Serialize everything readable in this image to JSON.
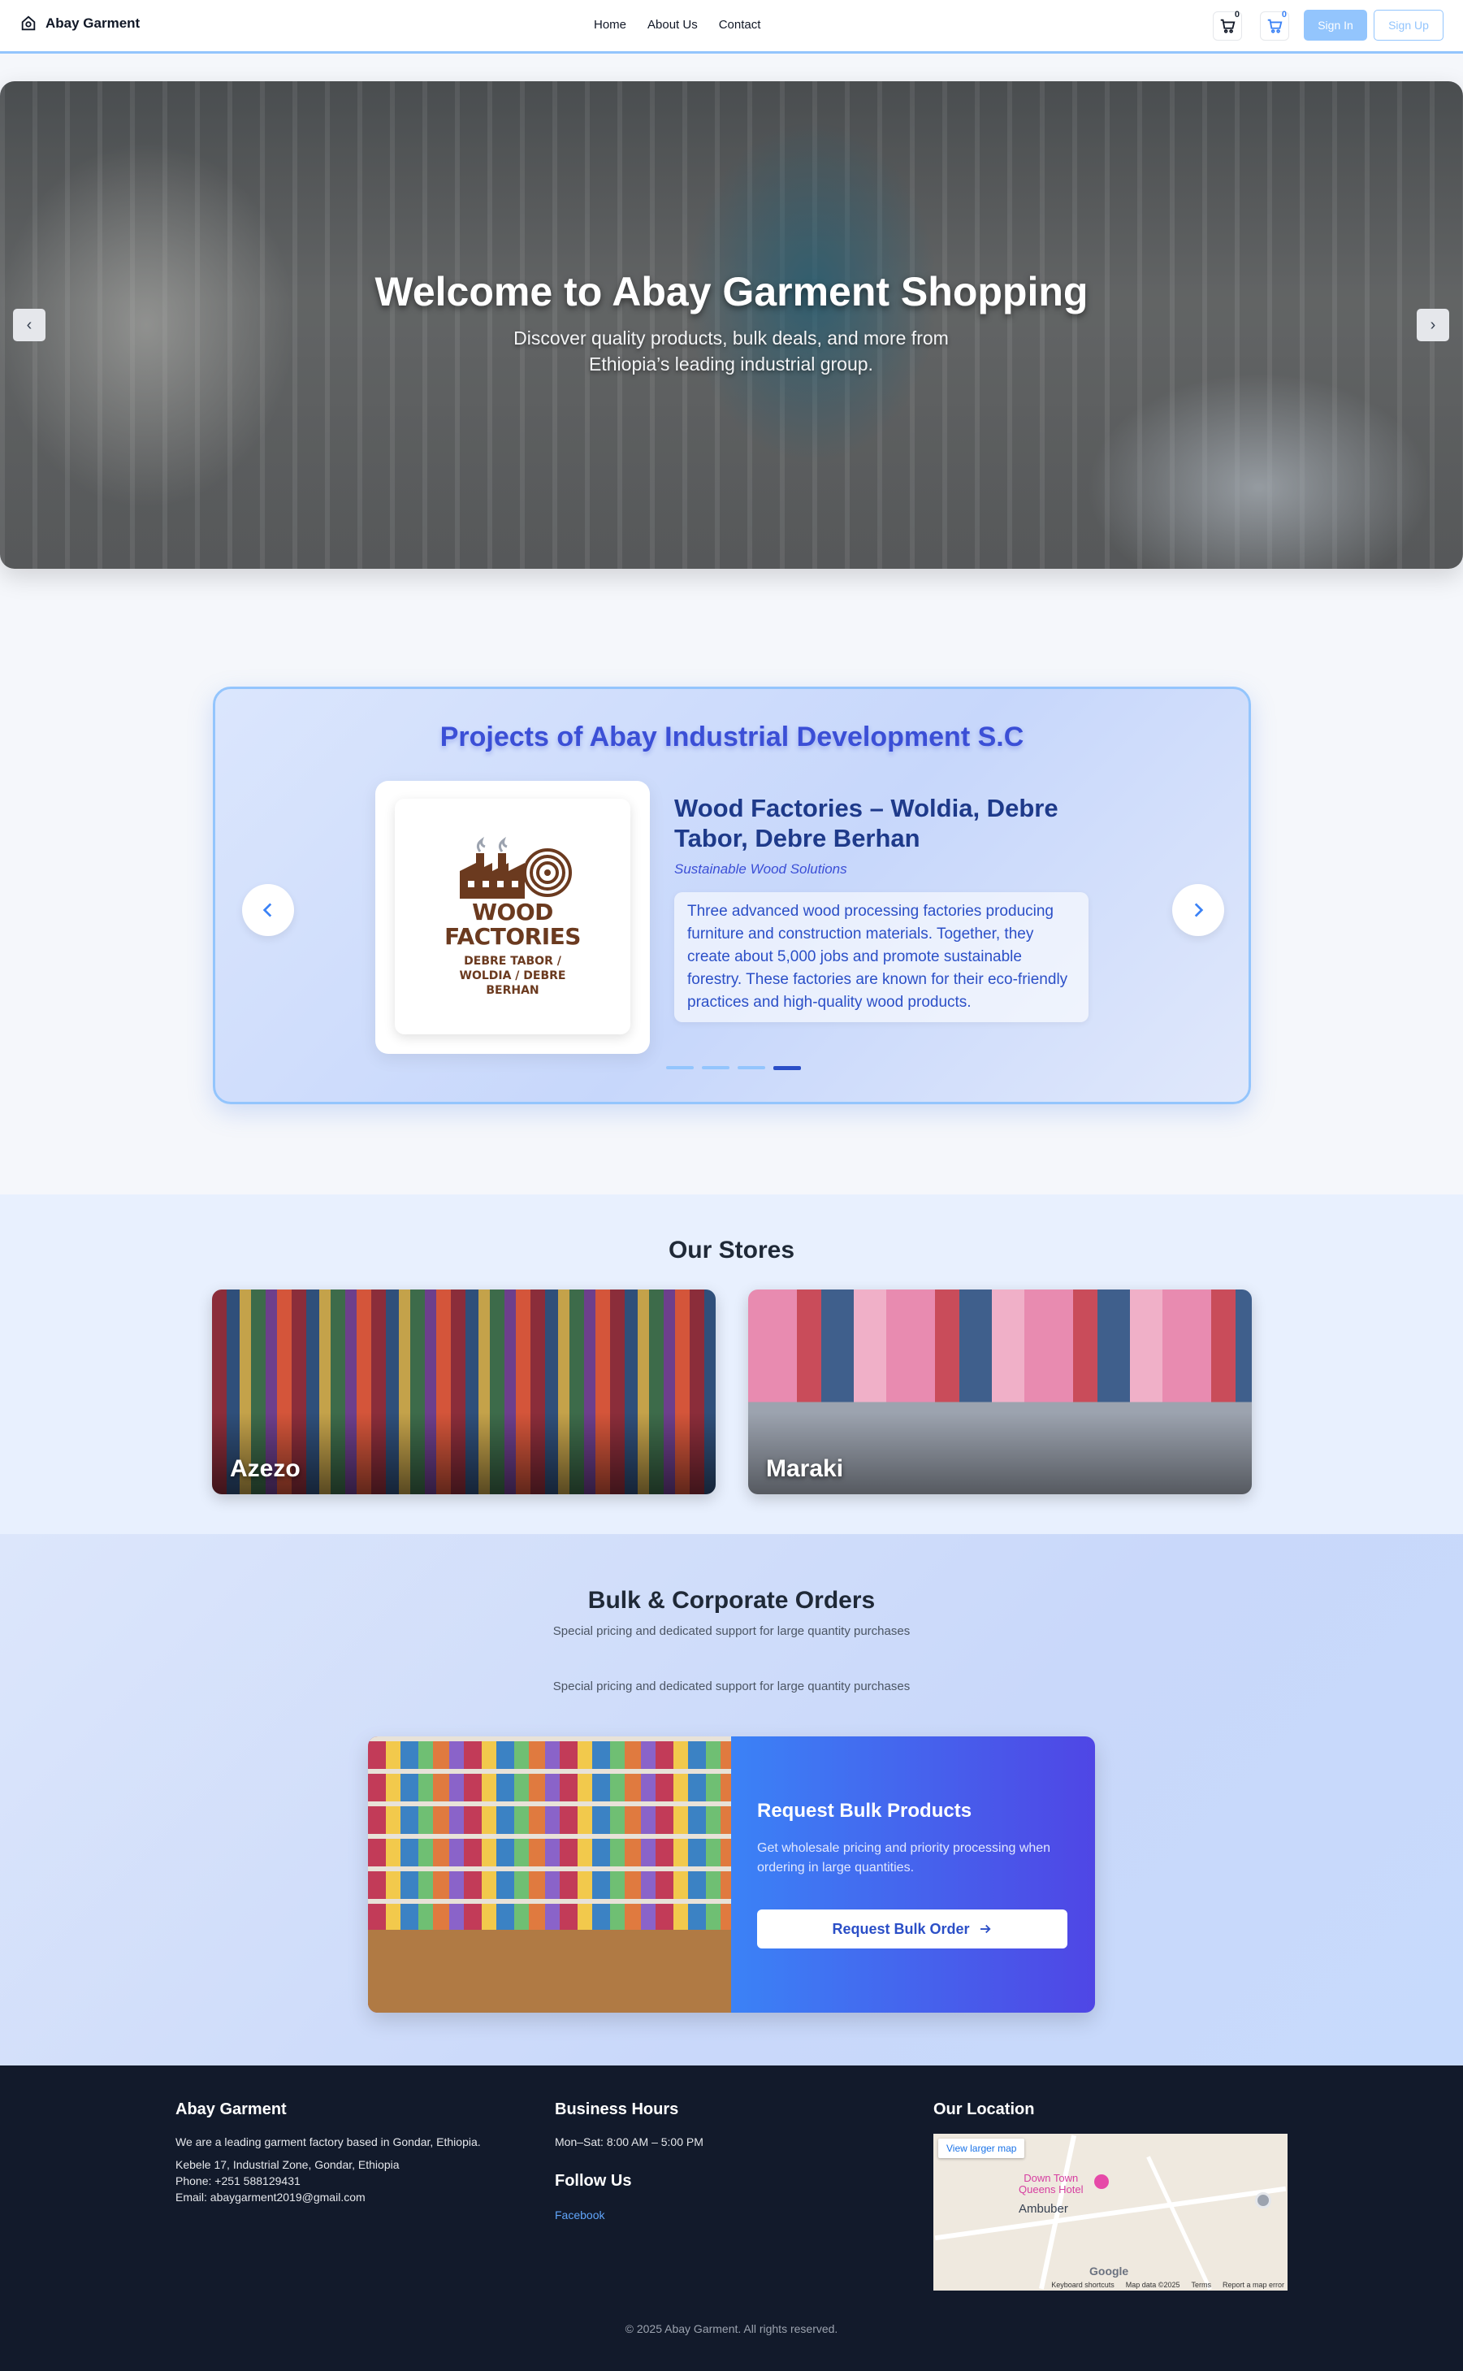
{
  "nav": {
    "brand": "Abay Garment",
    "links": [
      "Home",
      "About Us",
      "Contact"
    ],
    "cart_count_1": "0",
    "cart_count_2": "0",
    "signin": "Sign In",
    "signup": "Sign Up"
  },
  "hero": {
    "title": "Welcome to Abay Garment Shopping",
    "subtitle": "Discover quality products, bulk deals, and more from Ethiopia’s leading industrial group."
  },
  "projects": {
    "title": "Projects of Abay Industrial Development S.C",
    "logo_line1": "WOOD",
    "logo_line2": "FACTORIES",
    "logo_line3": "DEBRE TABOR /",
    "logo_line4": "WOLDIA / DEBRE",
    "logo_line5": "BERHAN",
    "name": "Wood Factories – Woldia, Debre Tabor, Debre Berhan",
    "tagline": "Sustainable Wood Solutions",
    "description": "Three advanced wood processing factories producing furniture and construction materials. Together, they create about 5,000 jobs and promote sustainable forestry. These factories are known for their eco-friendly practices and high-quality wood products.",
    "slide_count": 4,
    "active_slide": 4
  },
  "stores": {
    "title": "Our Stores",
    "items": [
      "Azezo",
      "Maraki"
    ]
  },
  "bulk": {
    "title": "Bulk & Corporate Orders",
    "subtitle1": "Special pricing and dedicated support for large quantity purchases",
    "subtitle2": "Special pricing and dedicated support for large quantity purchases",
    "card_title": "Request Bulk Products",
    "card_text": "Get wholesale pricing and priority processing when ordering in large quantities.",
    "button": "Request Bulk Order"
  },
  "footer": {
    "brand": "Abay Garment",
    "about": "We are a leading garment factory based in Gondar, Ethiopia.",
    "address": "Kebele 17, Industrial Zone, Gondar, Ethiopia",
    "phone": "Phone: +251 588129431",
    "email": "Email: abaygarment2019@gmail.com",
    "hours_title": "Business Hours",
    "hours": "Mon–Sat: 8:00 AM – 5:00 PM",
    "follow_title": "Follow Us",
    "facebook": "Facebook",
    "location_title": "Our Location",
    "map_button": "View larger map",
    "map_place": "Ambuber",
    "map_hotel_1": "Down Town",
    "map_hotel_2": "Queens Hotel",
    "map_logo": "Google",
    "map_shortcuts": "Keyboard shortcuts",
    "map_data": "Map data ©2025",
    "map_terms": "Terms",
    "map_report": "Report a map error",
    "copyright": "© 2025 Abay Garment. All rights reserved."
  }
}
